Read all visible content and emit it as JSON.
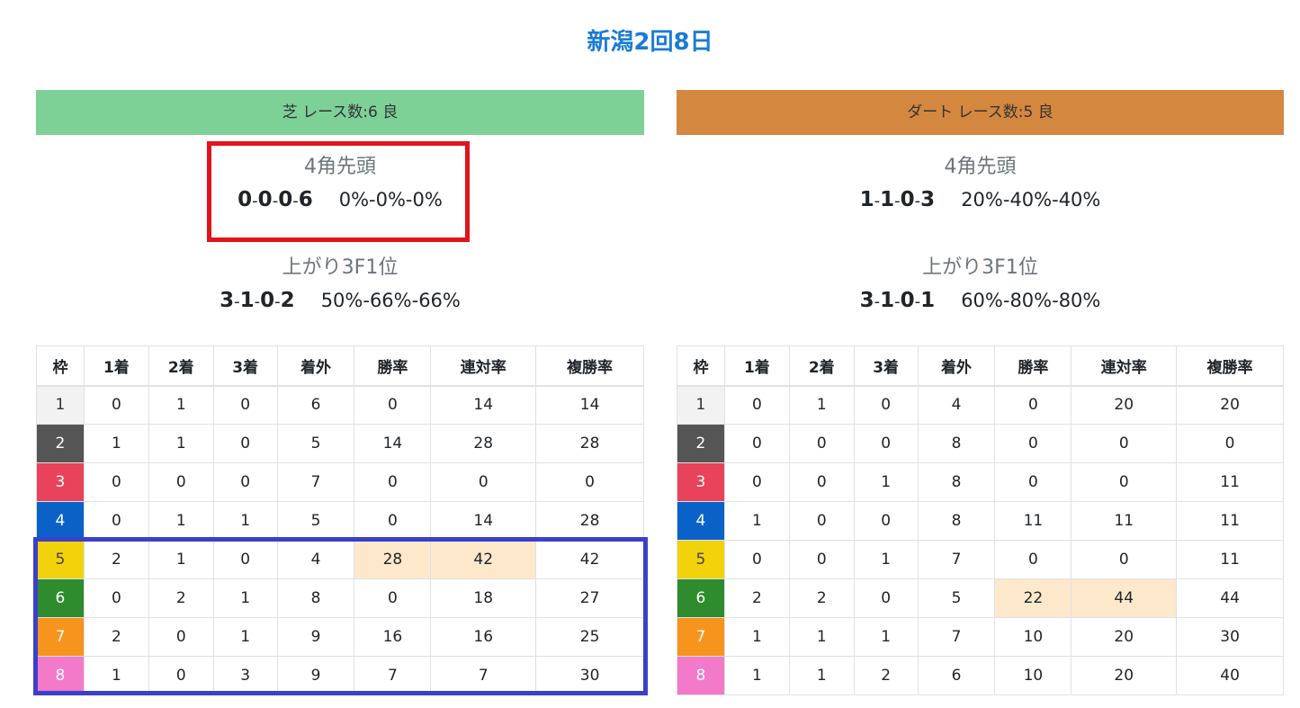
{
  "title": "新潟2回8日",
  "columns_header": [
    "枠",
    "1着",
    "2着",
    "3着",
    "着外",
    "勝率",
    "連対率",
    "複勝率"
  ],
  "gate_colors": {
    "1": {
      "bg": "#f2f2f2",
      "fg": "#333333"
    },
    "2": {
      "bg": "#555555",
      "fg": "#ffffff"
    },
    "3": {
      "bg": "#e8435a",
      "fg": "#ffffff"
    },
    "4": {
      "bg": "#0a62c9",
      "fg": "#ffffff"
    },
    "5": {
      "bg": "#f2d20b",
      "fg": "#444444"
    },
    "6": {
      "bg": "#2e8b2e",
      "fg": "#ffffff"
    },
    "7": {
      "bg": "#f7941d",
      "fg": "#ffffff"
    },
    "8": {
      "bg": "#f37ac9",
      "fg": "#ffffff"
    }
  },
  "turf": {
    "header": "芝 レース数:6 良",
    "header_color": "#7dd197",
    "corner4": {
      "heading": "4角先頭",
      "record": [
        "0",
        "0",
        "0",
        "6"
      ],
      "pct": "0%-0%-0%"
    },
    "last3f": {
      "heading": "上がり3F1位",
      "record": [
        "3",
        "1",
        "0",
        "2"
      ],
      "pct": "50%-66%-66%"
    },
    "rows": [
      {
        "gate": "1",
        "c1": "0",
        "c2": "1",
        "c3": "0",
        "out": "6",
        "win": "0",
        "rentai": "14",
        "fukusho": "14",
        "hl": []
      },
      {
        "gate": "2",
        "c1": "1",
        "c2": "1",
        "c3": "0",
        "out": "5",
        "win": "14",
        "rentai": "28",
        "fukusho": "28",
        "hl": []
      },
      {
        "gate": "3",
        "c1": "0",
        "c2": "0",
        "c3": "0",
        "out": "7",
        "win": "0",
        "rentai": "0",
        "fukusho": "0",
        "hl": []
      },
      {
        "gate": "4",
        "c1": "0",
        "c2": "1",
        "c3": "1",
        "out": "5",
        "win": "0",
        "rentai": "14",
        "fukusho": "28",
        "hl": []
      },
      {
        "gate": "5",
        "c1": "2",
        "c2": "1",
        "c3": "0",
        "out": "4",
        "win": "28",
        "rentai": "42",
        "fukusho": "42",
        "hl": [
          "win",
          "rentai"
        ]
      },
      {
        "gate": "6",
        "c1": "0",
        "c2": "2",
        "c3": "1",
        "out": "8",
        "win": "0",
        "rentai": "18",
        "fukusho": "27",
        "hl": []
      },
      {
        "gate": "7",
        "c1": "2",
        "c2": "0",
        "c3": "1",
        "out": "9",
        "win": "16",
        "rentai": "16",
        "fukusho": "25",
        "hl": []
      },
      {
        "gate": "8",
        "c1": "1",
        "c2": "0",
        "c3": "3",
        "out": "9",
        "win": "7",
        "rentai": "7",
        "fukusho": "30",
        "hl": []
      }
    ]
  },
  "dirt": {
    "header": "ダート レース数:5 良",
    "header_color": "#d4873f",
    "corner4": {
      "heading": "4角先頭",
      "record": [
        "1",
        "1",
        "0",
        "3"
      ],
      "pct": "20%-40%-40%"
    },
    "last3f": {
      "heading": "上がり3F1位",
      "record": [
        "3",
        "1",
        "0",
        "1"
      ],
      "pct": "60%-80%-80%"
    },
    "rows": [
      {
        "gate": "1",
        "c1": "0",
        "c2": "1",
        "c3": "0",
        "out": "4",
        "win": "0",
        "rentai": "20",
        "fukusho": "20",
        "hl": []
      },
      {
        "gate": "2",
        "c1": "0",
        "c2": "0",
        "c3": "0",
        "out": "8",
        "win": "0",
        "rentai": "0",
        "fukusho": "0",
        "hl": []
      },
      {
        "gate": "3",
        "c1": "0",
        "c2": "0",
        "c3": "1",
        "out": "8",
        "win": "0",
        "rentai": "0",
        "fukusho": "11",
        "hl": []
      },
      {
        "gate": "4",
        "c1": "1",
        "c2": "0",
        "c3": "0",
        "out": "8",
        "win": "11",
        "rentai": "11",
        "fukusho": "11",
        "hl": []
      },
      {
        "gate": "5",
        "c1": "0",
        "c2": "0",
        "c3": "1",
        "out": "7",
        "win": "0",
        "rentai": "0",
        "fukusho": "11",
        "hl": []
      },
      {
        "gate": "6",
        "c1": "2",
        "c2": "2",
        "c3": "0",
        "out": "5",
        "win": "22",
        "rentai": "44",
        "fukusho": "44",
        "hl": [
          "win",
          "rentai"
        ]
      },
      {
        "gate": "7",
        "c1": "1",
        "c2": "1",
        "c3": "1",
        "out": "7",
        "win": "10",
        "rentai": "20",
        "fukusho": "30",
        "hl": []
      },
      {
        "gate": "8",
        "c1": "1",
        "c2": "1",
        "c3": "2",
        "out": "6",
        "win": "10",
        "rentai": "20",
        "fukusho": "40",
        "hl": []
      }
    ]
  },
  "annotations": {
    "red_box_color": "#e3131b",
    "blue_box_color": "#3b3fc9"
  }
}
